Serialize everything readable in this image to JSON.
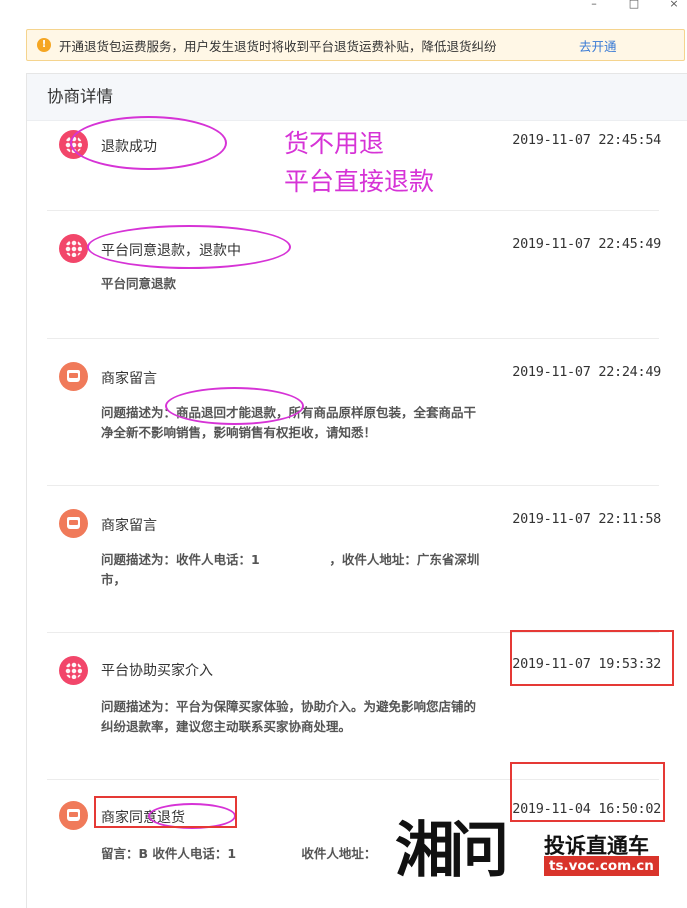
{
  "window_controls": {
    "minimize": "–",
    "maximize": "□",
    "close": "×"
  },
  "notice": {
    "text": "开通退货包运费服务，用户发生退货时将收到平台退货运费补贴，降低退货纠纷",
    "link": "去开通"
  },
  "panel": {
    "title": "协商详情"
  },
  "records": [
    {
      "icon": "platform-icon",
      "title": "退款成功",
      "time": "2019-11-07 22:45:54",
      "desc": ""
    },
    {
      "icon": "platform-icon",
      "title": "平台同意退款，退款中",
      "time": "2019-11-07 22:45:49",
      "desc": "平台同意退款"
    },
    {
      "icon": "merchant-icon",
      "title": "商家留言",
      "time": "2019-11-07 22:24:49",
      "desc": "问题描述为：商品退回才能退款，所有商品原样原包装，全套商品干净全新不影响销售，影响销售有权拒收，请知悉！"
    },
    {
      "icon": "merchant-icon",
      "title": "商家留言",
      "time": "2019-11-07 22:11:58",
      "desc": "问题描述为：收件人电话：1                ，收件人地址：广东省深圳市，"
    },
    {
      "icon": "platform-icon",
      "title": "平台协助买家介入",
      "time": "2019-11-07 19:53:32",
      "desc": "问题描述为：平台为保障买家体验，协助介入。为避免影响您店铺的纠纷退款率，建议您主动联系买家协商处理。"
    },
    {
      "icon": "merchant-icon",
      "title": "商家同意退货",
      "time": "2019-11-04 16:50:02",
      "desc": "留言：B 收件人电话：1               收件人地址："
    }
  ],
  "annotation": {
    "line1": "货不用退",
    "line2": "平台直接退款"
  },
  "watermark": {
    "glyphs": "湘问",
    "text": "投诉直通车",
    "url": "ts.voc.com.cn"
  },
  "colors": {
    "accent_link": "#3a7bd5",
    "annotation": "#d633d6",
    "highlight_box": "#e53935",
    "platform_icon": "#f2466a",
    "merchant_icon": "#f07a5a"
  }
}
